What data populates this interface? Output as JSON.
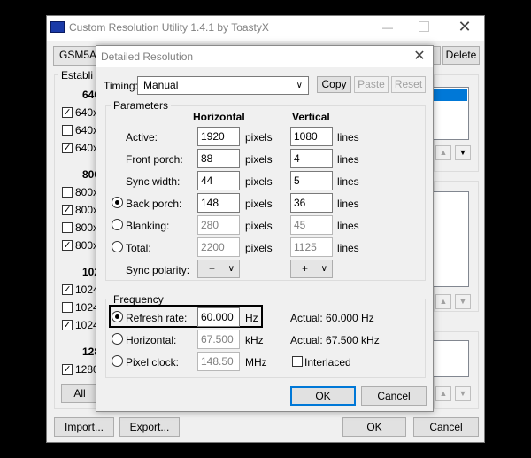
{
  "main": {
    "title": "Custom Resolution Utility 1.4.1 by ToastyX",
    "monitor_select": "GSM5AB8",
    "delete_label": "Delete",
    "established_label": "Establi",
    "groups": [
      {
        "heading": "640",
        "items": [
          {
            "label": "640x",
            "checked": true
          },
          {
            "label": "640x",
            "checked": false
          },
          {
            "label": "640x",
            "checked": true
          }
        ]
      },
      {
        "heading": "800",
        "items": [
          {
            "label": "800x",
            "checked": false
          },
          {
            "label": "800x",
            "checked": true
          },
          {
            "label": "800x",
            "checked": false
          },
          {
            "label": "800x",
            "checked": true
          }
        ]
      },
      {
        "heading": "102",
        "items": [
          {
            "label": "1024",
            "checked": true
          },
          {
            "label": "1024",
            "checked": false
          },
          {
            "label": "1024",
            "checked": true
          }
        ]
      },
      {
        "heading": "128",
        "items": [
          {
            "label": "1280",
            "checked": true
          }
        ]
      }
    ],
    "all_label": "All",
    "import_label": "Import...",
    "export_label": "Export...",
    "ok_label": "OK",
    "cancel_label": "Cancel"
  },
  "dialog": {
    "title": "Detailed Resolution",
    "timing_label": "Timing:",
    "timing_value": "Manual",
    "copy_label": "Copy",
    "paste_label": "Paste",
    "reset_label": "Reset",
    "parameters_label": "Parameters",
    "horizontal_header": "Horizontal",
    "vertical_header": "Vertical",
    "rows": [
      {
        "label": "Active:",
        "h": "1920",
        "hu": "pixels",
        "v": "1080",
        "vu": "lines"
      },
      {
        "label": "Front porch:",
        "h": "88",
        "hu": "pixels",
        "v": "4",
        "vu": "lines"
      },
      {
        "label": "Sync width:",
        "h": "44",
        "hu": "pixels",
        "v": "5",
        "vu": "lines"
      },
      {
        "label": "Back porch:",
        "h": "148",
        "hu": "pixels",
        "v": "36",
        "vu": "lines"
      },
      {
        "label": "Blanking:",
        "h": "280",
        "hu": "pixels",
        "v": "45",
        "vu": "lines"
      },
      {
        "label": "Total:",
        "h": "2200",
        "hu": "pixels",
        "v": "1125",
        "vu": "lines"
      }
    ],
    "sync_polarity_label": "Sync polarity:",
    "h_polarity": "+",
    "v_polarity": "+",
    "frequency_label": "Frequency",
    "refresh_label": "Refresh rate:",
    "refresh_value": "60.000",
    "refresh_unit": "Hz",
    "refresh_actual": "Actual: 60.000 Hz",
    "horizontal_label": "Horizontal:",
    "horizontal_value": "67.500",
    "horizontal_unit": "kHz",
    "horizontal_actual": "Actual: 67.500 kHz",
    "pixel_clock_label": "Pixel clock:",
    "pixel_clock_value": "148.50",
    "pixel_clock_unit": "MHz",
    "interlaced_label": "Interlaced",
    "ok_label": "OK",
    "cancel_label": "Cancel"
  }
}
